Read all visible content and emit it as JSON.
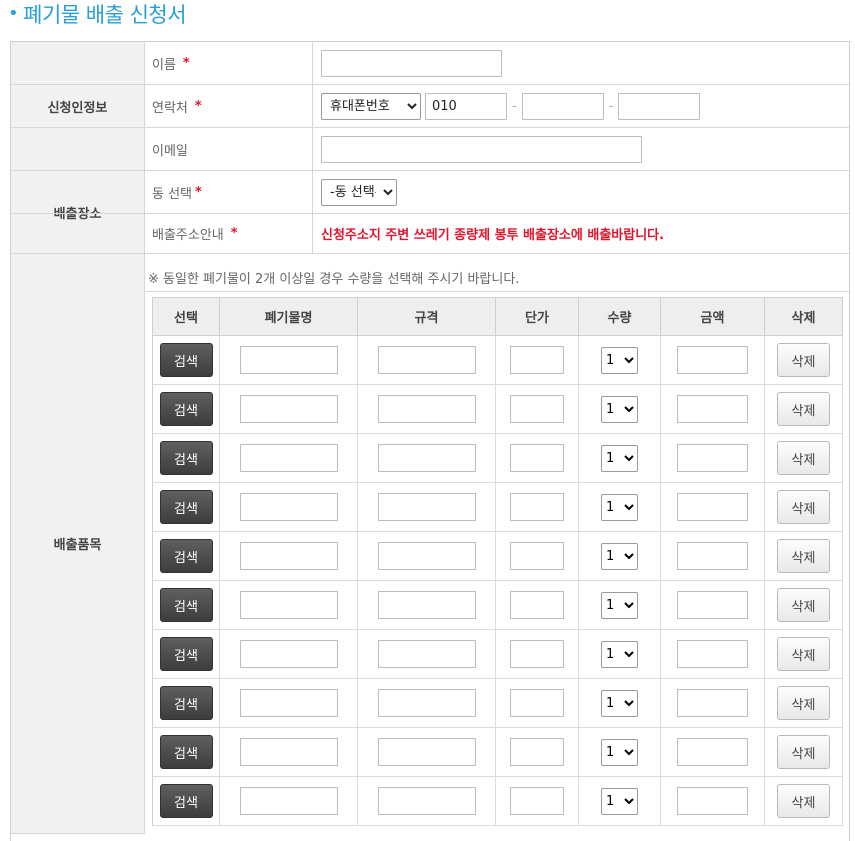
{
  "page": {
    "title": "폐기물 배출 신청서"
  },
  "sections": {
    "applicant": {
      "header": "신청인정보",
      "name_label": "이름",
      "contact_label": "연락처",
      "phone_type_selected": "휴대폰번호",
      "phone_prefix": "010",
      "phone_middle": "",
      "phone_last": "",
      "email_label": "이메일",
      "name_value": "",
      "email_value": ""
    },
    "location": {
      "header": "배출장소",
      "dong_label": "동 선택",
      "dong_selected": "-동 선택-",
      "address_label": "배출주소안내",
      "address_notice": "신청주소지 주변 쓰레기 종량제 봉투 배출장소에 배출바랍니다."
    },
    "items": {
      "header": "배출품목",
      "notice": "※ 동일한 폐기물이 2개 이상일 경우 수량을 선택해 주시기 바랍니다.",
      "columns": [
        "선택",
        "폐기물명",
        "규격",
        "단가",
        "수량",
        "금액",
        "삭제"
      ],
      "search_label": "검색",
      "delete_label": "삭제",
      "required_mark": "*",
      "rows": [
        {
          "qty": "1"
        },
        {
          "qty": "1"
        },
        {
          "qty": "1"
        },
        {
          "qty": "1"
        },
        {
          "qty": "1"
        },
        {
          "qty": "1"
        },
        {
          "qty": "1"
        },
        {
          "qty": "1"
        },
        {
          "qty": "1"
        },
        {
          "qty": "1"
        }
      ]
    }
  },
  "colors": {
    "title": "#2a9fd6",
    "required": "#e0142c",
    "search_button": "#4a4a4a"
  }
}
